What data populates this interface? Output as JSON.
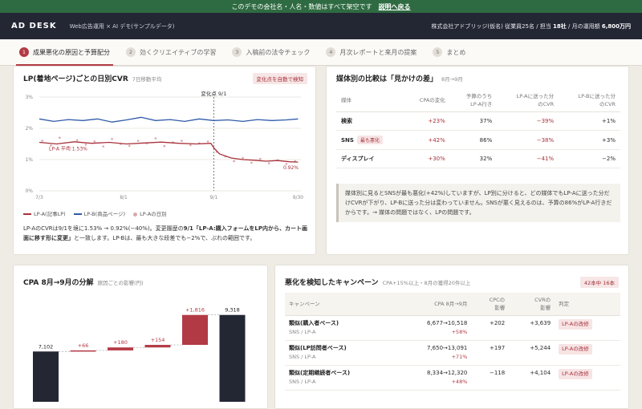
{
  "banner": {
    "text": "このデモの会社名・人名・数値はすべて架空です",
    "link": "説明へ戻る"
  },
  "app": {
    "brand": "AD DESK",
    "subtitle": "Web広告運用 × AI デモ(サンプルデータ)",
    "org_prefix": "株式会社アドブリッジ(仮名) 従業員25名 / 担当 ",
    "org_clients": "18社",
    "org_mid": " / 月の運用額 ",
    "org_budget": "6,800万円"
  },
  "tabs": [
    {
      "num": "1",
      "label": "成果悪化の原因と予算配分"
    },
    {
      "num": "2",
      "label": "効くクリエイティブの学習"
    },
    {
      "num": "3",
      "label": "入稿前の法令チェック"
    },
    {
      "num": "4",
      "label": "月次レポートと来月の提案"
    },
    {
      "num": "5",
      "label": "まとめ"
    }
  ],
  "cvr_card": {
    "title": "LP(着地ページ)ごとの日別CVR",
    "note": "7日移動平均",
    "badge": "変化点を自動で検知",
    "change_label": "変化点 9/1",
    "avg_label": "LP-A 平均 1.53%",
    "end_label": "0.92%",
    "legend": [
      "LP-A(記事LP)",
      "LP-B(商品ページ)",
      "LP-Aの日別"
    ],
    "text1": "LP-AのCVRは9/1を境に1.53% → 0.92%(−40%)。変更履歴の",
    "text_bold": "9/1「LP-A:購入フォームをLP内から、カート画面に移す形に変更」",
    "text2": "と一致します。LP-Bは、最も大きな段差でも−2%で、ぶれの範囲です。"
  },
  "chart_data": {
    "type": "line",
    "title": "LP(着地ページ)ごとの日別CVR",
    "ylabel": "CVR",
    "y_ticks": [
      "3%",
      "2%",
      "1%",
      "0%"
    ],
    "x_ticks": [
      "7/3",
      "8/1",
      "9/1",
      "9/30"
    ],
    "ylim": [
      0,
      3
    ],
    "x_days": [
      0,
      90
    ],
    "x_tick_days": [
      0,
      29,
      60,
      89
    ],
    "change_day": 60,
    "grid": true,
    "legend_position": "bottom",
    "series": [
      {
        "name": "LP-A(記事LP)",
        "color": "#a8323c",
        "x": [
          0,
          6,
          12,
          18,
          24,
          30,
          36,
          42,
          48,
          54,
          59,
          60,
          62,
          66,
          70,
          74,
          78,
          82,
          86,
          89
        ],
        "y": [
          1.55,
          1.5,
          1.57,
          1.52,
          1.55,
          1.5,
          1.53,
          1.56,
          1.52,
          1.5,
          1.52,
          1.38,
          1.18,
          1.05,
          1.0,
          0.98,
          0.95,
          0.97,
          0.93,
          0.92
        ]
      },
      {
        "name": "LP-B(商品ページ)",
        "color": "#2e5aa8",
        "x": [
          0,
          5,
          10,
          15,
          20,
          25,
          30,
          35,
          40,
          45,
          50,
          55,
          60,
          65,
          70,
          75,
          80,
          85,
          89
        ],
        "y": [
          2.3,
          2.22,
          2.28,
          2.25,
          2.3,
          2.2,
          2.27,
          2.35,
          2.25,
          2.28,
          2.22,
          2.3,
          2.25,
          2.27,
          2.22,
          2.28,
          2.25,
          2.27,
          2.3
        ]
      }
    ],
    "scatter": {
      "name": "LP-Aの日別",
      "color": "#dba7ad",
      "x": [
        1,
        4,
        7,
        10,
        13,
        16,
        19,
        22,
        25,
        28,
        31,
        34,
        37,
        40,
        43,
        46,
        49,
        52,
        55,
        58,
        61,
        64,
        67,
        70,
        73,
        76,
        79,
        82,
        85,
        88
      ],
      "y": [
        1.6,
        1.45,
        1.7,
        1.4,
        1.62,
        1.48,
        1.58,
        1.42,
        1.66,
        1.5,
        1.44,
        1.6,
        1.52,
        1.68,
        1.43,
        1.55,
        1.6,
        1.46,
        1.52,
        1.58,
        1.25,
        1.1,
        0.95,
        1.05,
        0.9,
        1.02,
        0.88,
        0.98,
        0.86,
        0.95
      ]
    }
  },
  "media_card": {
    "title": "媒体別の比較は「見かけの差」",
    "note": "8月→9月",
    "headers": [
      "媒体",
      "CPAの変化",
      "予算のうち\nLP-A行き",
      "LP-Aに送った分\nのCVR",
      "LP-Bに送った分\nのCVR"
    ],
    "rows": [
      {
        "name": "検索",
        "tag": "",
        "cpa": "+23%",
        "share": "37%",
        "cvr_a": "−39%",
        "cvr_b": "+1%"
      },
      {
        "name": "SNS",
        "tag": "最も悪化",
        "cpa": "+42%",
        "share": "86%",
        "cvr_a": "−38%",
        "cvr_b": "+3%"
      },
      {
        "name": "ディスプレイ",
        "tag": "",
        "cpa": "+30%",
        "share": "32%",
        "cvr_a": "−41%",
        "cvr_b": "−2%"
      }
    ],
    "quote": "媒体別に見るとSNSが最も悪化(+42%)していますが、LP別に分けると、どの媒体でもLP-Aに送った分だけCVRが下がり、LP-Bに送った分は変わっていません。SNSが悪く見えるのは、予算の86%がLP-A行きだからです。→ 媒体の問題ではなく、LPの問題です。"
  },
  "waterfall_card": {
    "title": "CPA 8月→9月の分解",
    "note": "原因ごとの影響(円)",
    "labels": [
      "7,102",
      "+66",
      "+180",
      "+154",
      "+1,816",
      "9,318"
    ],
    "values": [
      7102,
      66,
      180,
      154,
      1816,
      9318
    ]
  },
  "campaign_card": {
    "title": "悪化を検知したキャンペーン",
    "note": "CPA+15%以上・8月の獲得20件以上",
    "badge": "42本中 16本",
    "headers": [
      "キャンペーン",
      "CPA 8月→9月",
      "CPCの\n影響",
      "CVRの\n影響",
      "判定"
    ],
    "rows": [
      {
        "name": "類似(購入者ベース)",
        "sub": "SNS / LP-A",
        "cpa": "6,677→10,518",
        "pct": "+58%",
        "cpc": "+202",
        "cvr": "+3,639",
        "verdict": "LP-Aの改修"
      },
      {
        "name": "類似(LP訪問者ベース)",
        "sub": "SNS / LP-A",
        "cpa": "7,650→13,091",
        "pct": "+71%",
        "cpc": "+197",
        "cvr": "+5,244",
        "verdict": "LP-Aの改修"
      },
      {
        "name": "類似(定期継続者ベース)",
        "sub": "SNS / LP-A",
        "cpa": "8,334→12,320",
        "pct": "+48%",
        "cpc": "−118",
        "cvr": "+4,104",
        "verdict": "LP-Aの改修"
      }
    ]
  }
}
